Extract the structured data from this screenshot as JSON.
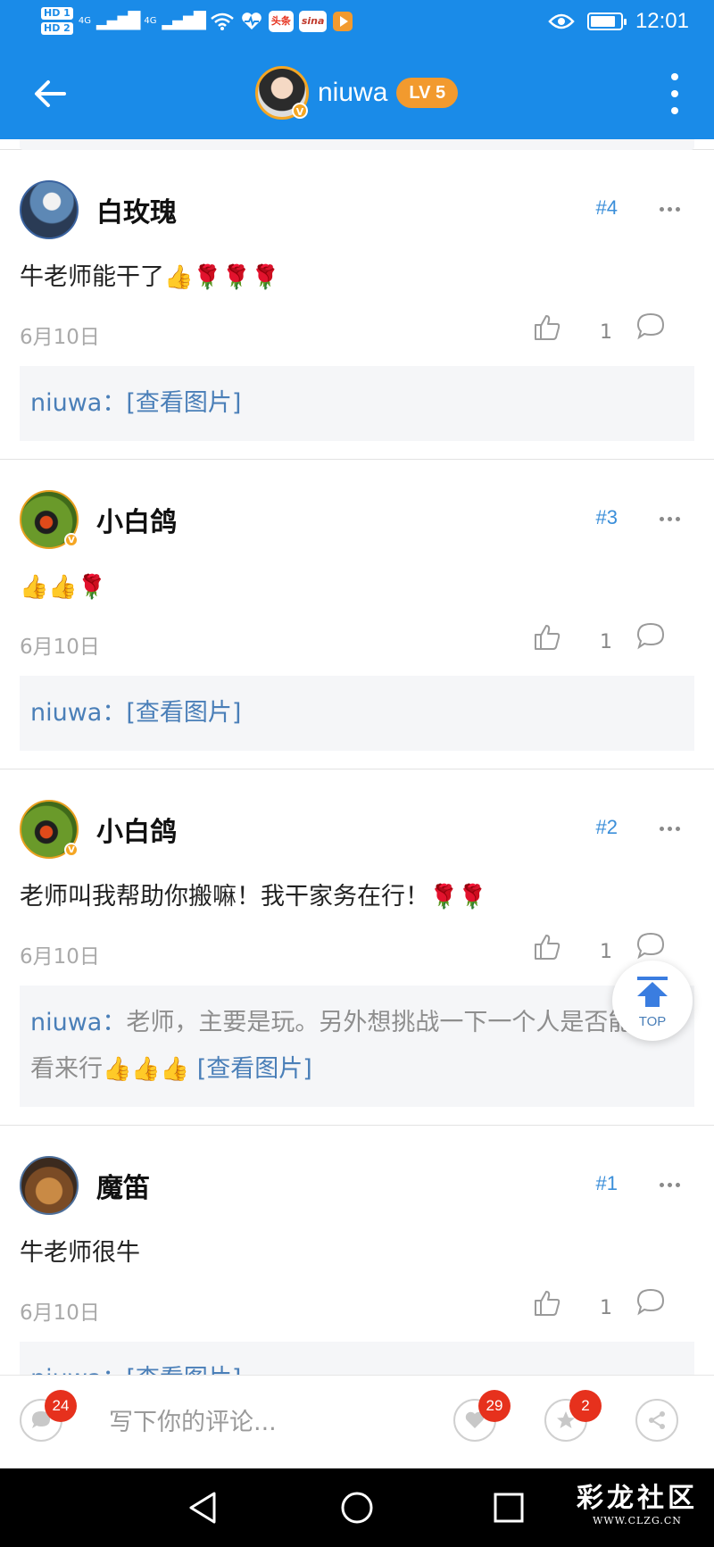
{
  "status_bar": {
    "hd1": "HD 1",
    "hd2": "HD 2",
    "signal1": "4G",
    "signal2": "4G",
    "app_icons": [
      "头条",
      "sina"
    ],
    "time": "12:01",
    "battery_level": 0.85
  },
  "header": {
    "username": "niuwa",
    "level_badge": "LV 5",
    "verified_mark": "V"
  },
  "posts": [
    {
      "username": "白玫瑰",
      "floor": "#4",
      "content": "牛老师能干了",
      "content_emojis": "👍🌹🌹🌹",
      "date": "6月10日",
      "likes": "1",
      "reply_author": "niuwa：",
      "reply_text": "",
      "reply_emojis": "",
      "reply_link": "[查看图片]"
    },
    {
      "username": "小白鸽",
      "floor": "#3",
      "content": "",
      "content_emojis": "👍👍🌹",
      "date": "6月10日",
      "likes": "1",
      "reply_author": "niuwa：",
      "reply_text": "",
      "reply_emojis": "",
      "reply_link": "[查看图片]"
    },
    {
      "username": "小白鸽",
      "floor": "#2",
      "content": "老师叫我帮助你搬嘛！我干家务在行！",
      "content_emojis": "🌹🌹",
      "date": "6月10日",
      "likes": "1",
      "reply_author": "niuwa：",
      "reply_text": "老师，主要是玩。另外想挑战一下一个人是否能行，看来行",
      "reply_emojis": "👍👍👍",
      "reply_link": "[查看图片]"
    },
    {
      "username": "魔笛",
      "floor": "#1",
      "content": "牛老师很牛",
      "content_emojis": "",
      "date": "6月10日",
      "likes": "1",
      "reply_author": "niuwa：",
      "reply_text": "",
      "reply_emojis": "",
      "reply_link": "[查看图片]"
    }
  ],
  "top_button": {
    "label": "TOP"
  },
  "bottom_bar": {
    "input_placeholder": "写下你的评论...",
    "comments_count": "24",
    "likes_count": "29",
    "favorites_count": "2"
  },
  "watermark": {
    "line1": "彩龙社区",
    "line2": "WWW.CLZG.CN"
  },
  "colors": {
    "brand_blue": "#1a8be8",
    "link_blue": "#4a7fb8",
    "badge_red": "#e6311d",
    "level_orange": "#f29a2e"
  }
}
